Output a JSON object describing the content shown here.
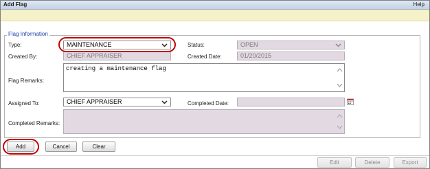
{
  "window": {
    "title": "Add Flag",
    "help_label": "Help"
  },
  "section": {
    "legend": "Flag Information"
  },
  "form": {
    "type": {
      "label": "Type:",
      "value": "MAINTENANCE"
    },
    "status": {
      "label": "Status:",
      "value": "OPEN"
    },
    "created_by": {
      "label": "Created By:",
      "value": "CHIEF APPRAISER"
    },
    "created_date": {
      "label": "Created Date:",
      "value": "01/20/2015"
    },
    "flag_remarks": {
      "label": "Flag Remarks:",
      "value": "creating a maintenance flag"
    },
    "assigned_to": {
      "label": "Assigned To:",
      "value": "CHIEF APPRAISER"
    },
    "completed_date": {
      "label": "Completed Date:",
      "value": ""
    },
    "completed_remarks": {
      "label": "Completed Remarks:",
      "value": ""
    }
  },
  "actions": {
    "add": "Add",
    "cancel": "Cancel",
    "clear": "Clear"
  },
  "footer": {
    "edit": "Edit",
    "delete": "Delete",
    "export": "Export"
  },
  "colors": {
    "highlight_ring": "#c00000",
    "legend_text": "#1a3fa8",
    "message_bar": "#f5f1c8",
    "disabled_field": "#e2d9e3"
  },
  "icons": [
    "chevron-down-icon",
    "scroll-up-icon",
    "scroll-down-icon",
    "calendar-icon"
  ]
}
